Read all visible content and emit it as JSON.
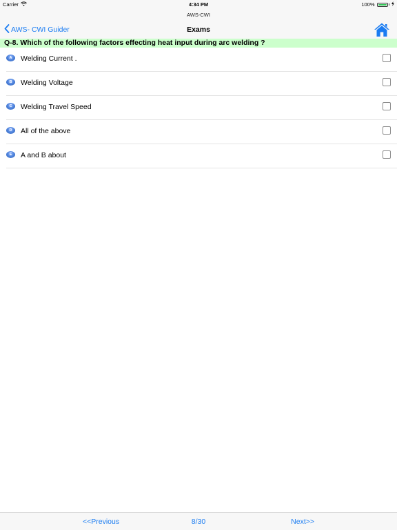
{
  "status_bar": {
    "carrier": "Carrier",
    "time": "4:34 PM",
    "battery": "100%"
  },
  "app_title": "AWS-CWI",
  "nav": {
    "back_label": "AWS- CWI Guider",
    "title": "Exams"
  },
  "question": {
    "text": "Q-8. Which of the following factors effecting heat input during arc welding ?"
  },
  "options": [
    {
      "letter": "A",
      "text": "Welding Current ."
    },
    {
      "letter": "B",
      "text": "Welding Voltage"
    },
    {
      "letter": "C",
      "text": "Welding Travel Speed"
    },
    {
      "letter": "D",
      "text": "All of the above"
    },
    {
      "letter": "E",
      "text": "A and B about"
    }
  ],
  "pager": {
    "previous_label": "<<Previous",
    "counter": "8/30",
    "next_label": "Next>>"
  },
  "colors": {
    "accent": "#1a7cf2",
    "question_bg": "#ccffcc",
    "battery": "#34c759"
  },
  "icons": {
    "wifi": "wifi-icon",
    "battery": "battery-icon",
    "charging": "charging-icon",
    "back": "chevron-left-icon",
    "home": "home-icon"
  }
}
